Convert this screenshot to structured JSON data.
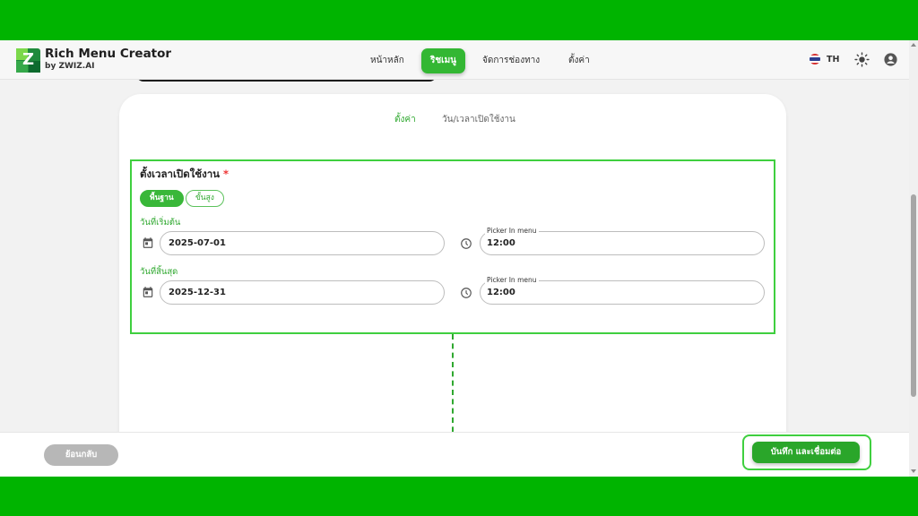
{
  "brand": {
    "title": "Rich Menu Creator",
    "subtitle": "by ZWIZ.AI",
    "logo_letter": "Z"
  },
  "nav": {
    "items": [
      {
        "label": "หน้าหลัก"
      },
      {
        "label": "ริชเมนู",
        "active": true
      },
      {
        "label": "จัดการช่องทาง"
      },
      {
        "label": "ตั้งค่า"
      }
    ]
  },
  "header_right": {
    "language": "TH",
    "icons": [
      "thai-flag-icon",
      "sun-icon",
      "user-account-icon"
    ]
  },
  "tabs": [
    {
      "label": "ตั้งค่า",
      "active": true
    },
    {
      "label": "วัน/เวลาเปิดใช้งาน",
      "active": false
    }
  ],
  "schedule": {
    "title": "ตั้งเวลาเปิดใช้งาน",
    "required_mark": "*",
    "modes": [
      {
        "label": "พื้นฐาน",
        "selected": true
      },
      {
        "label": "ขั้นสูง",
        "selected": false
      }
    ],
    "start": {
      "label": "วันที่เริ่มต้น",
      "date": "2025-07-01",
      "time_label": "Picker In menu",
      "time": "12:00"
    },
    "end": {
      "label": "วันที่สิ้นสุด",
      "date": "2025-12-31",
      "time_label": "Picker In menu",
      "time": "12:00"
    }
  },
  "footer": {
    "back_label": "ย้อนกลับ",
    "save_label": "บันทึก และเชื่อมต่อ"
  },
  "colors": {
    "primary_green": "#2aa62a",
    "highlight_border": "#3fcf3f",
    "background_green": "#00b400"
  }
}
